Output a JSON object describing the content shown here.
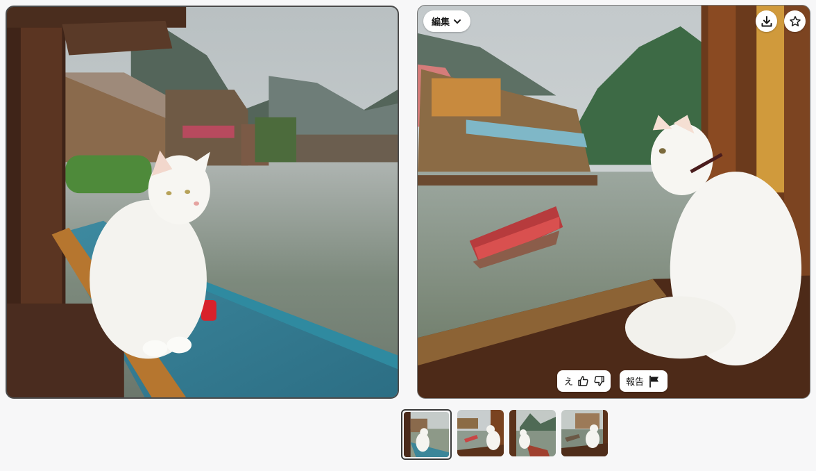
{
  "images": {
    "left": {
      "selected": true
    },
    "right": {
      "selected": false
    }
  },
  "toolbar": {
    "edit_label": "編集",
    "edit_icon": "chevron-down-icon",
    "download_icon": "download-icon",
    "favorite_icon": "star-icon"
  },
  "feedback": {
    "prefix": "え",
    "like_icon": "thumbs-up-icon",
    "dislike_icon": "thumbs-down-icon",
    "report_label": "報告",
    "report_icon": "flag-icon"
  },
  "thumbnails": [
    {
      "selected": true
    },
    {
      "selected": false
    },
    {
      "selected": false
    },
    {
      "selected": false
    }
  ]
}
